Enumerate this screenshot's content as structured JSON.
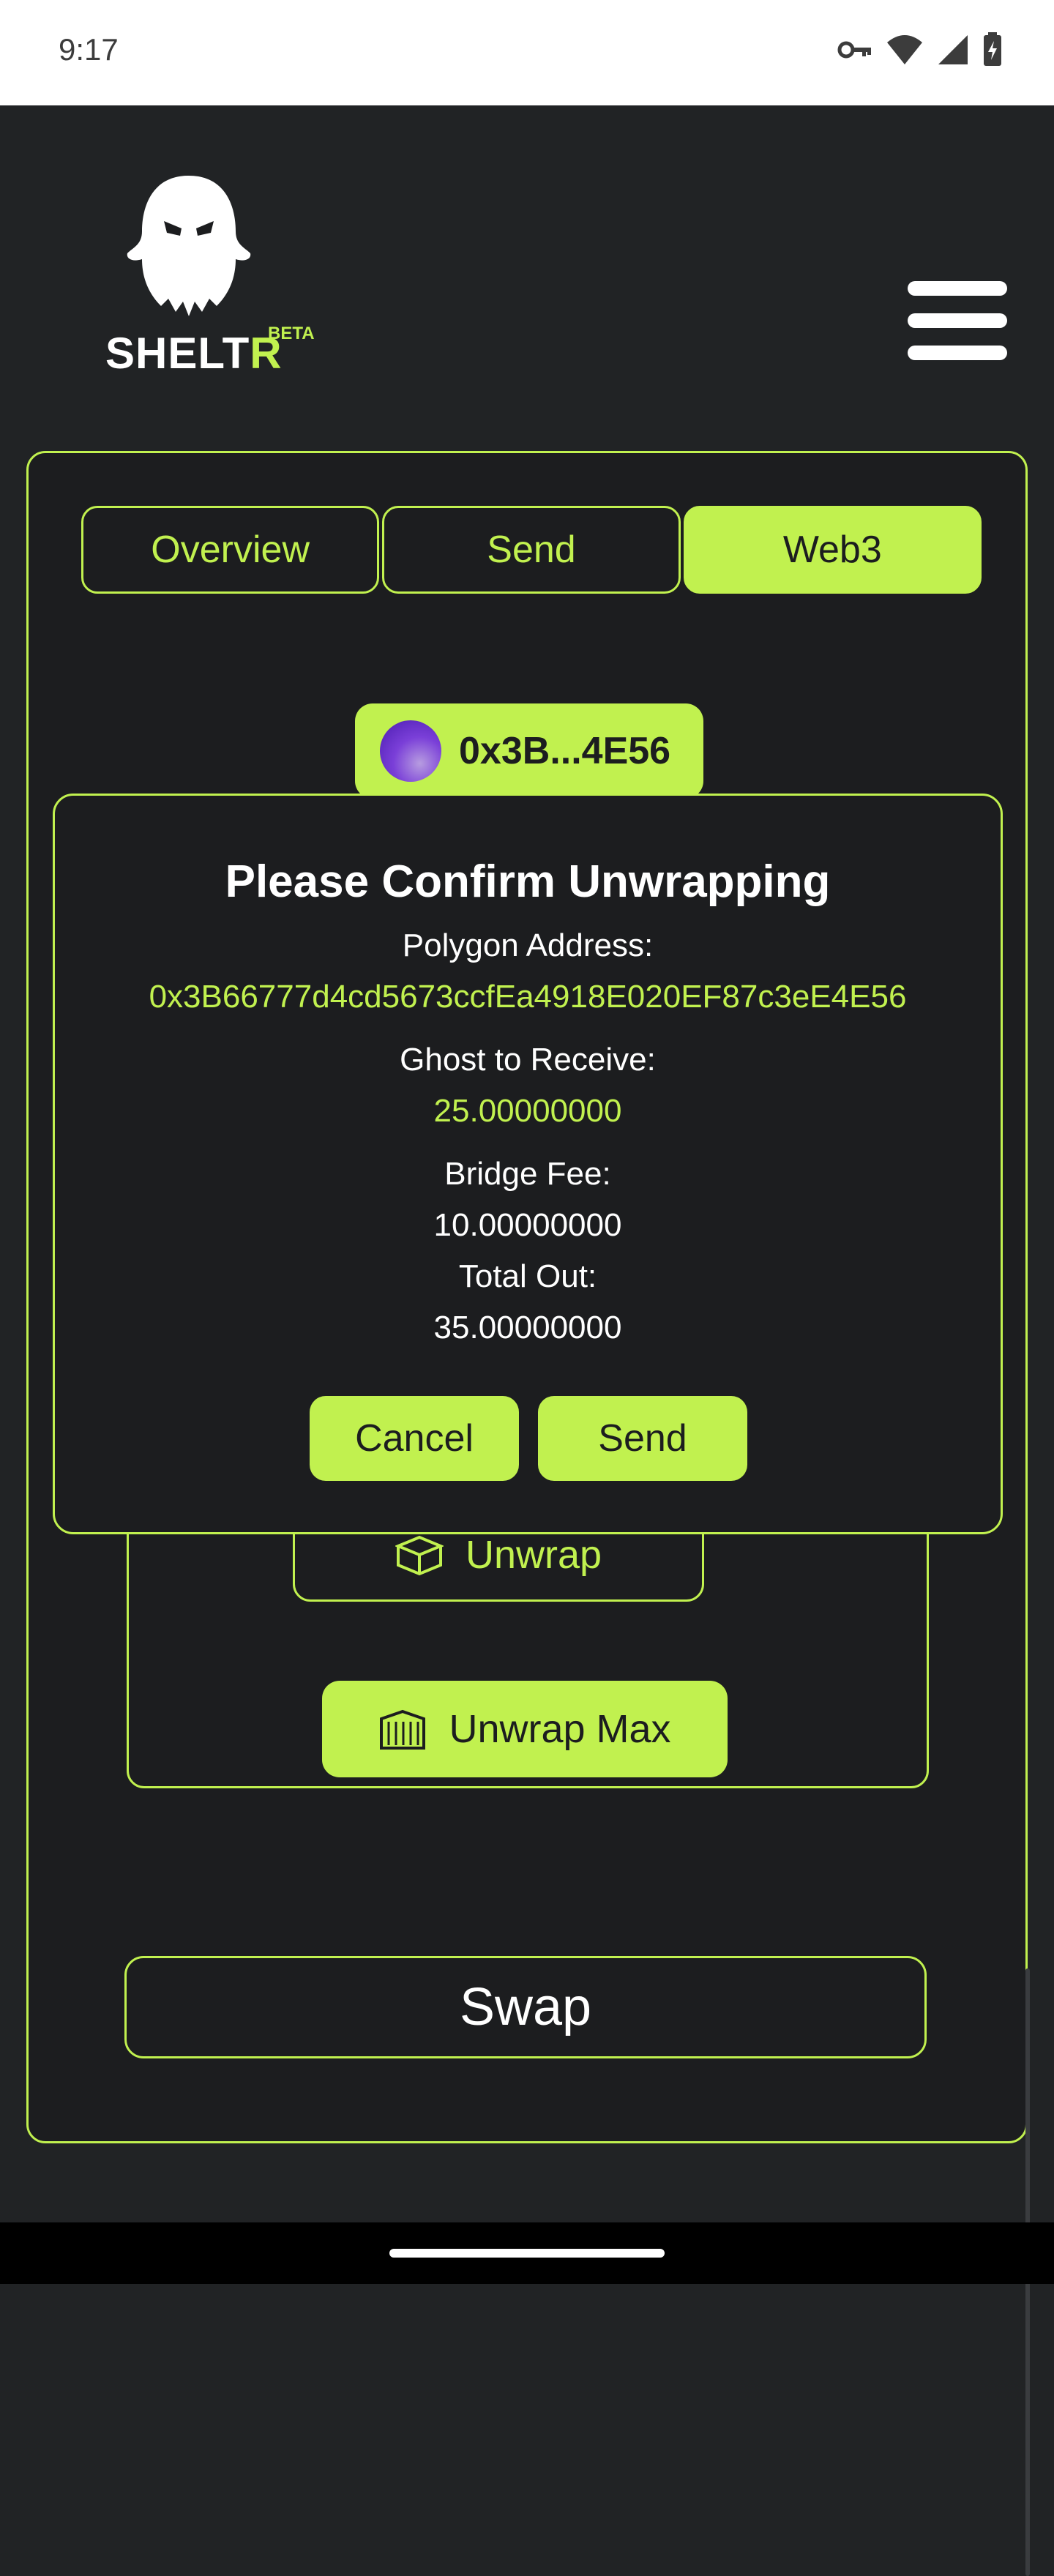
{
  "status_bar": {
    "time": "9:17",
    "icons": [
      "key-icon",
      "wifi-icon",
      "signal-icon",
      "battery-charging-icon"
    ]
  },
  "header": {
    "logo_text_main": "SHELT",
    "logo_text_accent": "R",
    "logo_badge": "BETA",
    "menu_icon": "hamburger-menu-icon"
  },
  "tabs": [
    {
      "label": "Overview",
      "active": false
    },
    {
      "label": "Send",
      "active": false
    },
    {
      "label": "Web3",
      "active": true
    }
  ],
  "wallet": {
    "short_address": "0x3B...4E56"
  },
  "unwrap_panel": {
    "unwrap_label": "Unwrap",
    "unwrap_icon": "box-icon",
    "unwrap_max_label": "Unwrap Max",
    "unwrap_max_icon": "container-icon"
  },
  "swap_label": "Swap",
  "modal": {
    "title": "Please Confirm Unwrapping",
    "address_label": "Polygon Address:",
    "address_value": "0x3B66777d4cd5673ccfEa4918E020EF87c3eE4E56",
    "receive_label": "Ghost to Receive:",
    "receive_value": "25.00000000",
    "fee_label": "Bridge Fee:",
    "fee_value": "10.00000000",
    "total_label": "Total Out:",
    "total_value": "35.00000000",
    "cancel_label": "Cancel",
    "send_label": "Send"
  },
  "colors": {
    "accent": "#c1f14f",
    "background": "#212325",
    "card": "#1c1d1f"
  }
}
